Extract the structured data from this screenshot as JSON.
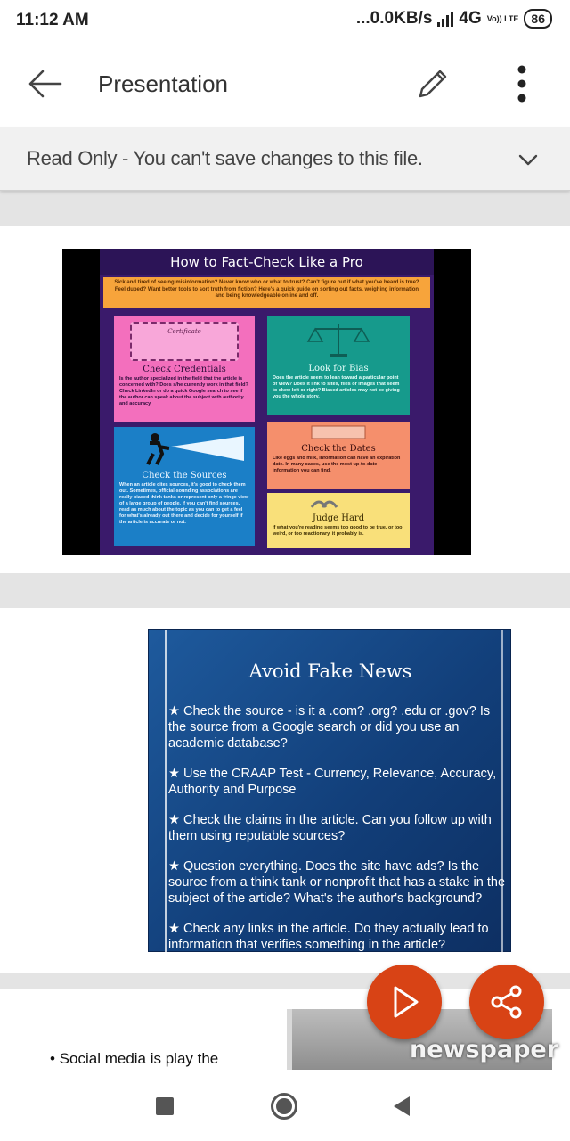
{
  "status_bar": {
    "time": "11:12 AM",
    "network_speed": "...0.0KB/s",
    "network_type": "4G",
    "volte_label": "Vo)) LTE",
    "battery": "86"
  },
  "app_bar": {
    "title": "Presentation",
    "back_icon": "arrow-left-icon",
    "edit_icon": "pencil-icon",
    "more_icon": "more-vertical-icon"
  },
  "banner": {
    "text": "Read Only - You can't save changes to this file.",
    "icon": "chevron-down-icon"
  },
  "slide1": {
    "title": "How to Fact-Check Like a Pro",
    "intro": "Sick and tired of seeing misinformation? Never know who or what to trust? Can't figure out if what you've heard is true? Feel duped? Want better tools to sort truth from fiction? Here's a quick guide on sorting out facts, weighing information and being knowledgeable online and off.",
    "certificate_label": "Certificate",
    "cards": [
      {
        "heading": "Check Credentials",
        "body": "Is the author specialized in the field that the article is concerned with? Does s/he currently work in that field? Check LinkedIn or do a quick Google search to see if the author can speak about the subject with authority and accuracy."
      },
      {
        "heading": "Look for Bias",
        "body": "Does the article seem to lean toward a particular point of view? Does it link to sites, files or images that seem to skew left or right? Biased articles may not be giving you the whole story."
      },
      {
        "heading": "Check the Sources",
        "body": "When an article cites sources, it's good to check them out. Sometimes, official-sounding associations are really biased think tanks or represent only a fringe view of a large group of people. If you can't find sources, read as much about the topic as you can to get a feel for what's already out there and decide for yourself if the article is accurate or not."
      },
      {
        "heading": "Check the Dates",
        "body": "Like eggs and milk, information can have an expiration date. In many cases, use the most up-to-date information you can find."
      },
      {
        "heading": "Judge Hard",
        "body": "If what you're reading seems too good to be true, or too weird, or too reactionary, it probably is."
      }
    ]
  },
  "slide2": {
    "title": "Avoid Fake News",
    "items": [
      "★ Check the source - is it a .com? .org? .edu or .gov? Is the source from a Google search or did you use an academic database?",
      "★ Use the CRAAP Test - Currency, Relevance, Accuracy, Authority and Purpose",
      "★ Check the claims in the article. Can you follow up with them using reputable sources?",
      "★ Question everything. Does the site have ads? Is the source from a think tank or nonprofit that has a stake in the subject of the article? What's the author's background?",
      "★ Check any links in the article. Do they actually lead to information that verifies something in the article?"
    ]
  },
  "slide3": {
    "bullet": "• Social media is play the",
    "image_text": "newspaper"
  },
  "fabs": {
    "play_icon": "play-icon",
    "share_icon": "share-icon"
  },
  "nav_bar": {
    "recents_icon": "square-icon",
    "home_icon": "circle-icon",
    "back_icon": "triangle-back-icon"
  },
  "colors": {
    "accent": "#d84315",
    "banner_bg": "#f1f1f1",
    "slide2_bg": "#123f7a"
  }
}
